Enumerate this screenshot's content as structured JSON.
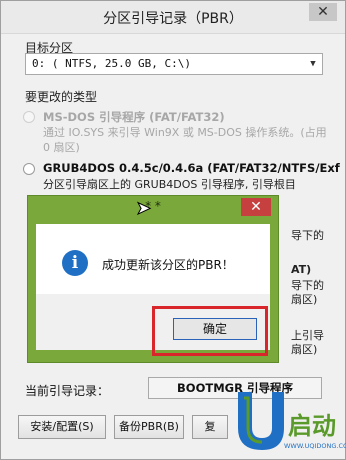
{
  "window": {
    "title": "分区引导记录（PBR）",
    "close_glyph": "✕"
  },
  "target_partition": {
    "label": "目标分区",
    "value": "0: ( NTFS,  25.0 GB, C:\\)"
  },
  "types": {
    "label": "要更改的类型",
    "options": [
      {
        "title": "MS-DOS 引导程序 (FAT/FAT32)",
        "desc": "通过 IO.SYS 来引导 Win9X 或 MS-DOS 操作系统。(占用 0 扇区)"
      },
      {
        "title": "GRUB4DOS 0.4.5c/0.4.6a (FAT/FAT32/NTFS/Exf",
        "desc": "分区引导扇区上的 GRUB4DOS 引导程序, 引导根目"
      }
    ],
    "occluded_fragments": [
      "导下的",
      "AT)",
      "导下的",
      "扇区)",
      "上引导",
      "扇区)"
    ]
  },
  "current": {
    "label": "当前引导记录：",
    "value": "BOOTMGR 引导程序"
  },
  "buttons": {
    "install": "安装/配置(S)",
    "backup": "备份PBR(B)",
    "restore": "复"
  },
  "message": {
    "title": "* *",
    "close_glyph": "✕",
    "icon_glyph": "i",
    "text": "成功更新该分区的PBR！",
    "ok": "确定"
  },
  "logo": {
    "brand": "U启动",
    "url": "WWW.UQIDONG.COM"
  },
  "colors": {
    "msg_frame": "#7aa83a",
    "highlight": "#d8262a",
    "info_icon": "#1f6fc4",
    "logo_blue": "#1f6fc4",
    "logo_green": "#5a9a2a"
  }
}
